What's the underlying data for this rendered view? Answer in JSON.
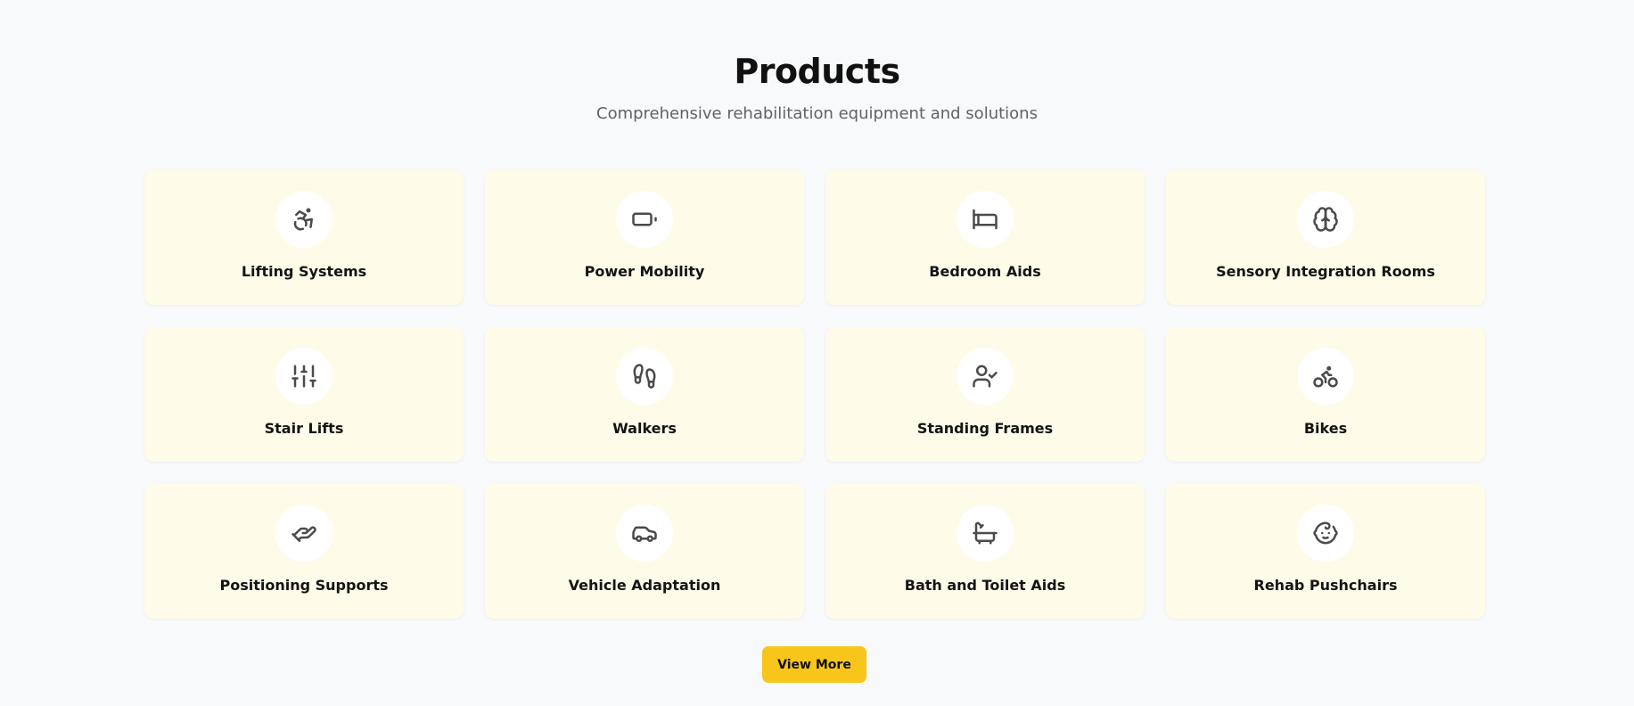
{
  "section": {
    "title": "Products",
    "subtitle": "Comprehensive rehabilitation equipment and solutions"
  },
  "products": [
    {
      "label": "Lifting Systems",
      "icon": "accessibility-icon"
    },
    {
      "label": "Power Mobility",
      "icon": "battery-icon"
    },
    {
      "label": "Bedroom Aids",
      "icon": "bed-icon"
    },
    {
      "label": "Sensory Integration Rooms",
      "icon": "brain-icon"
    },
    {
      "label": "Stair Lifts",
      "icon": "sliders-icon"
    },
    {
      "label": "Walkers",
      "icon": "footprints-icon"
    },
    {
      "label": "Standing Frames",
      "icon": "user-check-icon"
    },
    {
      "label": "Bikes",
      "icon": "bike-icon"
    },
    {
      "label": "Positioning Supports",
      "icon": "hand-helping-icon"
    },
    {
      "label": "Vehicle Adaptation",
      "icon": "car-icon"
    },
    {
      "label": "Bath and Toilet Aids",
      "icon": "bath-icon"
    },
    {
      "label": "Rehab Pushchairs",
      "icon": "baby-icon"
    }
  ],
  "actions": {
    "view_more_label": "View More"
  },
  "colors": {
    "page_background": "#f8f9fa",
    "card_background": "#fefbe8",
    "icon_circle": "#ffffff",
    "icon_stroke": "#4b4b4b",
    "button_accent": "#f8c51b"
  }
}
